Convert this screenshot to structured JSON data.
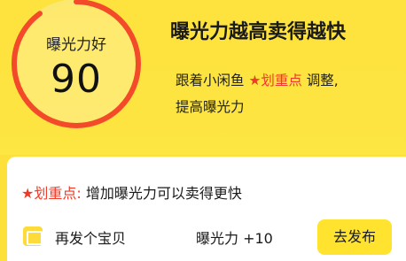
{
  "gauge": {
    "label": "曝光力好",
    "score": "90",
    "fill_fraction": 0.9,
    "ring_color": "#f34b2a",
    "track_color": "#fbe870"
  },
  "headline": "曝光力越高卖得越快",
  "description": {
    "prefix": "跟着小闲鱼",
    "highlight": "★划重点",
    "suffix": "调整,",
    "line2": "提高曝光力"
  },
  "card": {
    "tip_highlight": "★划重点:",
    "tip_text": "增加曝光力可以卖得更快",
    "task": {
      "icon": "folder-icon",
      "title": "再发个宝贝",
      "gain": "曝光力 +10",
      "button_label": "去发布"
    }
  },
  "colors": {
    "accent_red": "#f03a28",
    "brand_yellow": "#fde03a"
  }
}
